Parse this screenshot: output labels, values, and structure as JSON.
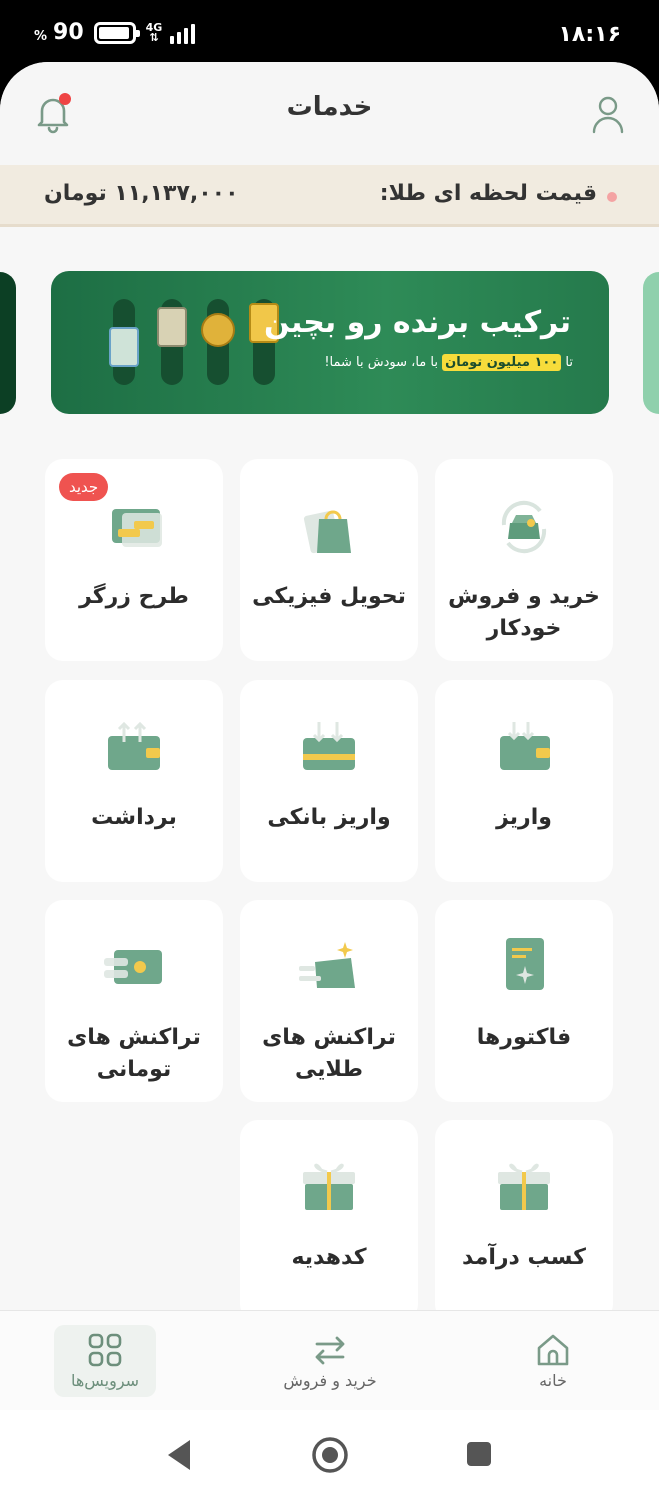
{
  "status_bar": {
    "time": "۱۸:۱۶",
    "battery": "90",
    "battery_unit": "%",
    "network": "4G"
  },
  "header": {
    "title": "خدمات"
  },
  "gold_price": {
    "label": "قیمت لحظه ای طلا:",
    "value": "۱۱,۱۳۷,۰۰۰ تومان"
  },
  "banner": {
    "title": "ترکیب برنده رو بچین",
    "subtitle_prefix": "تا",
    "subtitle_highlight": "۱۰۰ میلیون تومان",
    "subtitle_suffix": "با ما، سودش با شما!"
  },
  "services": [
    {
      "label": "خرید و فروش خودکار",
      "icon": "auto-trade-icon",
      "badge": ""
    },
    {
      "label": "تحویل فیزیکی",
      "icon": "shopping-bag-icon",
      "badge": ""
    },
    {
      "label": "طرح زرگر",
      "icon": "gold-bar-card-icon",
      "badge": "جدید"
    },
    {
      "label": "واریز",
      "icon": "wallet-deposit-icon",
      "badge": ""
    },
    {
      "label": "واریز بانکی",
      "icon": "bank-deposit-icon",
      "badge": ""
    },
    {
      "label": "برداشت",
      "icon": "wallet-withdraw-icon",
      "badge": ""
    },
    {
      "label": "فاکتورها",
      "icon": "invoice-icon",
      "badge": ""
    },
    {
      "label": "تراکنش های طلایی",
      "icon": "gold-transactions-icon",
      "badge": ""
    },
    {
      "label": "تراکنش های تومانی",
      "icon": "toman-transactions-icon",
      "badge": ""
    },
    {
      "label": "کسب درآمد",
      "icon": "gift-earn-icon",
      "badge": ""
    },
    {
      "label": "کدهدیه",
      "icon": "gift-code-icon",
      "badge": ""
    }
  ],
  "bottom_nav": {
    "home": "خانه",
    "trade": "خرید و فروش",
    "services": "سرویس‌ها",
    "active": "services"
  },
  "colors": {
    "primary_green": "#2e8b57",
    "icon_green": "#5e9c7c",
    "gold": "#f2c94c",
    "badge_red": "#ef5350"
  }
}
